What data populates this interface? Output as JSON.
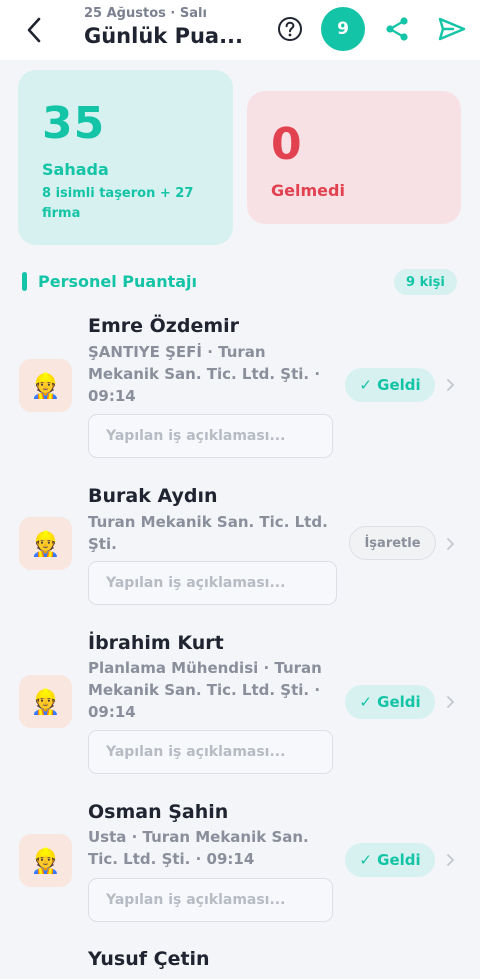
{
  "header": {
    "date": "25 Ağustos · Salı",
    "title": "Günlük Pua...",
    "count": "9"
  },
  "stats": {
    "present": {
      "value": "35",
      "label": "Sahada",
      "sub": "8 isimli taşeron + 27 firma"
    },
    "absent": {
      "value": "0",
      "label": "Gelmedi"
    }
  },
  "section": {
    "title": "Personel Puantajı",
    "badge": "9 kişi"
  },
  "input_placeholder": "Yapılan iş açıklaması...",
  "personnel": [
    {
      "name": "Emre Özdemir",
      "meta": "ŞANTIYE ŞEFİ · Turan Mekanik San. Tic. Ltd. Şti. · 09:14",
      "status": "✓ Geldi",
      "avatar": "👷"
    },
    {
      "name": "Burak Aydın",
      "meta": "Turan Mekanik San. Tic. Ltd. Şti.",
      "status": "İşaretle",
      "avatar": "👷"
    },
    {
      "name": "İbrahim Kurt",
      "meta": "Planlama Mühendisi · Turan Mekanik San. Tic. Ltd. Şti. · 09:14",
      "status": "✓ Geldi",
      "avatar": "👷"
    },
    {
      "name": "Osman Şahin",
      "meta": "Usta · Turan Mekanik San. Tic. Ltd. Şti. · 09:14",
      "status": "✓ Geldi",
      "avatar": "👷"
    },
    {
      "name": "Yusuf Çetin"
    }
  ],
  "colors": {
    "accent": "#14c4a6",
    "danger": "#e2414f",
    "accent_bg": "#d6f1f0",
    "danger_bg": "#f7e1e5"
  },
  "icons": [
    "back-arrow-icon",
    "help-circle-icon",
    "share-icon",
    "send-icon",
    "worker-icon",
    "chevron-right-icon",
    "check-icon"
  ]
}
